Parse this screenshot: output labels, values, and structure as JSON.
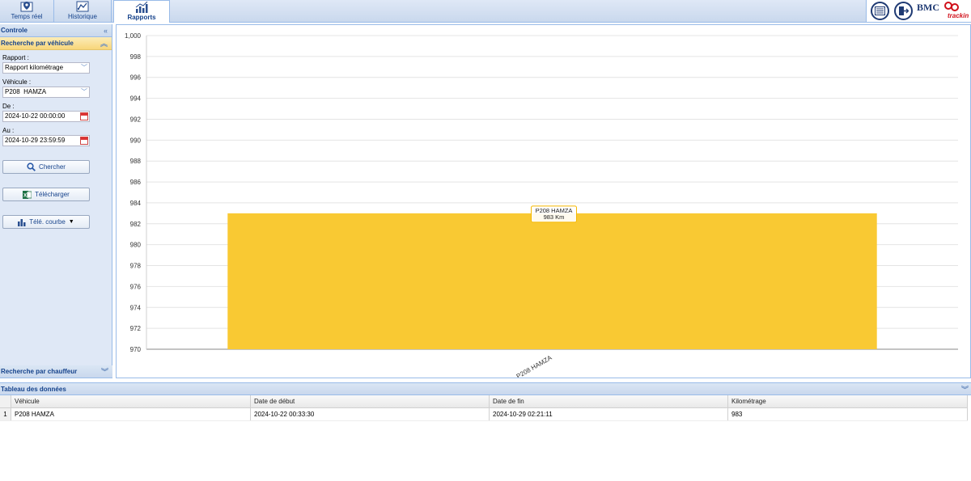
{
  "tabs": [
    {
      "label": "Temps réel",
      "icon": "map-pin-icon"
    },
    {
      "label": "Historique",
      "icon": "map-icon"
    },
    {
      "label": "Rapports",
      "icon": "bar-chart-icon"
    }
  ],
  "brand": {
    "name": "BMC",
    "tagline": "trackin"
  },
  "left_panel": {
    "title": "Controle",
    "section_title": "Recherche par véhicule",
    "rapport_label": "Rapport :",
    "rapport_value": "Rapport kilométrage",
    "vehicule_label": "Véhicule :",
    "vehicule_value": "P208  HAMZA",
    "de_label": "De :",
    "de_value": "2024-10-22 00:00:00",
    "au_label": "Au :",
    "au_value": "2024-10-29 23:59:59",
    "search_button": "Chercher",
    "download_button": "Télécharger",
    "curve_button": "Télé. courbe",
    "driver_section_title": "Recherche par chauffeur"
  },
  "chart_data": {
    "type": "bar",
    "categories": [
      "P208 HAMZA"
    ],
    "values": [
      983
    ],
    "ylim": [
      970,
      1000
    ],
    "yticks": [
      970,
      972,
      974,
      976,
      978,
      980,
      982,
      984,
      986,
      988,
      990,
      992,
      994,
      996,
      998,
      1000
    ],
    "ytick_labels": [
      "970",
      "972",
      "974",
      "976",
      "978",
      "980",
      "982",
      "984",
      "986",
      "988",
      "990",
      "992",
      "994",
      "996",
      "998",
      "1,000"
    ],
    "tooltip": {
      "line1": "P208 HAMZA",
      "line2": "983 Km"
    },
    "bar_color": "#f9c933",
    "grid": true
  },
  "table": {
    "title": "Tableau des données",
    "columns": [
      "Véhicule",
      "Date de début",
      "Date de fin",
      "Kilométrage"
    ],
    "rows": [
      {
        "index": "1",
        "cells": [
          "P208 HAMZA",
          "2024-10-22 00:33:30",
          "2024-10-29 02:21:11",
          "983"
        ]
      }
    ]
  }
}
